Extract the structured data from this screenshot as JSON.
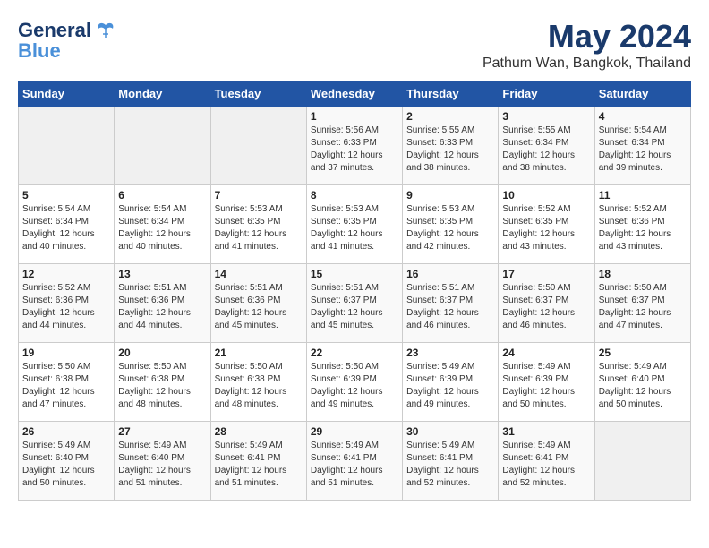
{
  "logo": {
    "line1": "General",
    "line2": "Blue"
  },
  "title": "May 2024",
  "location": "Pathum Wan, Bangkok, Thailand",
  "days_of_week": [
    "Sunday",
    "Monday",
    "Tuesday",
    "Wednesday",
    "Thursday",
    "Friday",
    "Saturday"
  ],
  "weeks": [
    [
      {
        "day": "",
        "sunrise": "",
        "sunset": "",
        "daylight": ""
      },
      {
        "day": "",
        "sunrise": "",
        "sunset": "",
        "daylight": ""
      },
      {
        "day": "",
        "sunrise": "",
        "sunset": "",
        "daylight": ""
      },
      {
        "day": "1",
        "sunrise": "Sunrise: 5:56 AM",
        "sunset": "Sunset: 6:33 PM",
        "daylight": "Daylight: 12 hours and 37 minutes."
      },
      {
        "day": "2",
        "sunrise": "Sunrise: 5:55 AM",
        "sunset": "Sunset: 6:33 PM",
        "daylight": "Daylight: 12 hours and 38 minutes."
      },
      {
        "day": "3",
        "sunrise": "Sunrise: 5:55 AM",
        "sunset": "Sunset: 6:34 PM",
        "daylight": "Daylight: 12 hours and 38 minutes."
      },
      {
        "day": "4",
        "sunrise": "Sunrise: 5:54 AM",
        "sunset": "Sunset: 6:34 PM",
        "daylight": "Daylight: 12 hours and 39 minutes."
      }
    ],
    [
      {
        "day": "5",
        "sunrise": "Sunrise: 5:54 AM",
        "sunset": "Sunset: 6:34 PM",
        "daylight": "Daylight: 12 hours and 40 minutes."
      },
      {
        "day": "6",
        "sunrise": "Sunrise: 5:54 AM",
        "sunset": "Sunset: 6:34 PM",
        "daylight": "Daylight: 12 hours and 40 minutes."
      },
      {
        "day": "7",
        "sunrise": "Sunrise: 5:53 AM",
        "sunset": "Sunset: 6:35 PM",
        "daylight": "Daylight: 12 hours and 41 minutes."
      },
      {
        "day": "8",
        "sunrise": "Sunrise: 5:53 AM",
        "sunset": "Sunset: 6:35 PM",
        "daylight": "Daylight: 12 hours and 41 minutes."
      },
      {
        "day": "9",
        "sunrise": "Sunrise: 5:53 AM",
        "sunset": "Sunset: 6:35 PM",
        "daylight": "Daylight: 12 hours and 42 minutes."
      },
      {
        "day": "10",
        "sunrise": "Sunrise: 5:52 AM",
        "sunset": "Sunset: 6:35 PM",
        "daylight": "Daylight: 12 hours and 43 minutes."
      },
      {
        "day": "11",
        "sunrise": "Sunrise: 5:52 AM",
        "sunset": "Sunset: 6:36 PM",
        "daylight": "Daylight: 12 hours and 43 minutes."
      }
    ],
    [
      {
        "day": "12",
        "sunrise": "Sunrise: 5:52 AM",
        "sunset": "Sunset: 6:36 PM",
        "daylight": "Daylight: 12 hours and 44 minutes."
      },
      {
        "day": "13",
        "sunrise": "Sunrise: 5:51 AM",
        "sunset": "Sunset: 6:36 PM",
        "daylight": "Daylight: 12 hours and 44 minutes."
      },
      {
        "day": "14",
        "sunrise": "Sunrise: 5:51 AM",
        "sunset": "Sunset: 6:36 PM",
        "daylight": "Daylight: 12 hours and 45 minutes."
      },
      {
        "day": "15",
        "sunrise": "Sunrise: 5:51 AM",
        "sunset": "Sunset: 6:37 PM",
        "daylight": "Daylight: 12 hours and 45 minutes."
      },
      {
        "day": "16",
        "sunrise": "Sunrise: 5:51 AM",
        "sunset": "Sunset: 6:37 PM",
        "daylight": "Daylight: 12 hours and 46 minutes."
      },
      {
        "day": "17",
        "sunrise": "Sunrise: 5:50 AM",
        "sunset": "Sunset: 6:37 PM",
        "daylight": "Daylight: 12 hours and 46 minutes."
      },
      {
        "day": "18",
        "sunrise": "Sunrise: 5:50 AM",
        "sunset": "Sunset: 6:37 PM",
        "daylight": "Daylight: 12 hours and 47 minutes."
      }
    ],
    [
      {
        "day": "19",
        "sunrise": "Sunrise: 5:50 AM",
        "sunset": "Sunset: 6:38 PM",
        "daylight": "Daylight: 12 hours and 47 minutes."
      },
      {
        "day": "20",
        "sunrise": "Sunrise: 5:50 AM",
        "sunset": "Sunset: 6:38 PM",
        "daylight": "Daylight: 12 hours and 48 minutes."
      },
      {
        "day": "21",
        "sunrise": "Sunrise: 5:50 AM",
        "sunset": "Sunset: 6:38 PM",
        "daylight": "Daylight: 12 hours and 48 minutes."
      },
      {
        "day": "22",
        "sunrise": "Sunrise: 5:50 AM",
        "sunset": "Sunset: 6:39 PM",
        "daylight": "Daylight: 12 hours and 49 minutes."
      },
      {
        "day": "23",
        "sunrise": "Sunrise: 5:49 AM",
        "sunset": "Sunset: 6:39 PM",
        "daylight": "Daylight: 12 hours and 49 minutes."
      },
      {
        "day": "24",
        "sunrise": "Sunrise: 5:49 AM",
        "sunset": "Sunset: 6:39 PM",
        "daylight": "Daylight: 12 hours and 50 minutes."
      },
      {
        "day": "25",
        "sunrise": "Sunrise: 5:49 AM",
        "sunset": "Sunset: 6:40 PM",
        "daylight": "Daylight: 12 hours and 50 minutes."
      }
    ],
    [
      {
        "day": "26",
        "sunrise": "Sunrise: 5:49 AM",
        "sunset": "Sunset: 6:40 PM",
        "daylight": "Daylight: 12 hours and 50 minutes."
      },
      {
        "day": "27",
        "sunrise": "Sunrise: 5:49 AM",
        "sunset": "Sunset: 6:40 PM",
        "daylight": "Daylight: 12 hours and 51 minutes."
      },
      {
        "day": "28",
        "sunrise": "Sunrise: 5:49 AM",
        "sunset": "Sunset: 6:41 PM",
        "daylight": "Daylight: 12 hours and 51 minutes."
      },
      {
        "day": "29",
        "sunrise": "Sunrise: 5:49 AM",
        "sunset": "Sunset: 6:41 PM",
        "daylight": "Daylight: 12 hours and 51 minutes."
      },
      {
        "day": "30",
        "sunrise": "Sunrise: 5:49 AM",
        "sunset": "Sunset: 6:41 PM",
        "daylight": "Daylight: 12 hours and 52 minutes."
      },
      {
        "day": "31",
        "sunrise": "Sunrise: 5:49 AM",
        "sunset": "Sunset: 6:41 PM",
        "daylight": "Daylight: 12 hours and 52 minutes."
      },
      {
        "day": "",
        "sunrise": "",
        "sunset": "",
        "daylight": ""
      }
    ]
  ]
}
